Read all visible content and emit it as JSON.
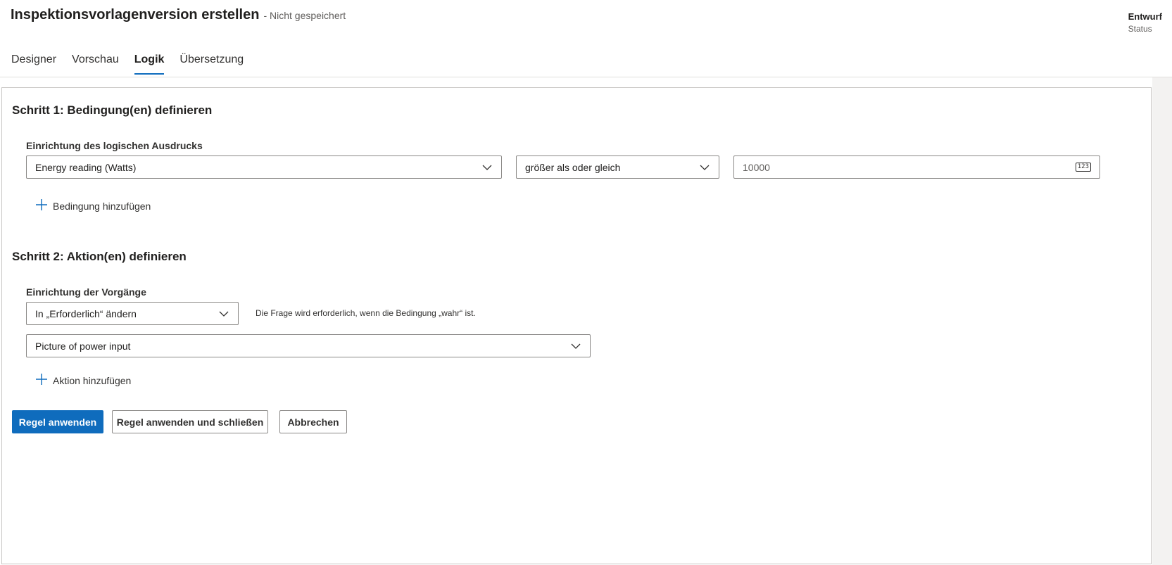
{
  "header": {
    "title": "Inspektionsvorlagenversion erstellen",
    "save_status": "- Nicht gespeichert",
    "status_value": "Entwurf",
    "status_label": "Status"
  },
  "tabs": [
    {
      "label": "Designer",
      "active": false
    },
    {
      "label": "Vorschau",
      "active": false
    },
    {
      "label": "Logik",
      "active": true
    },
    {
      "label": "Übersetzung",
      "active": false
    }
  ],
  "step1": {
    "title": "Schritt 1: Bedingung(en) definieren",
    "field_label": "Einrichtung des logischen Ausdrucks",
    "question_value": "Energy reading (Watts)",
    "operator_value": "größer als oder gleich",
    "number_value": "10000",
    "number_badge": "123",
    "add_condition_label": "Bedingung hinzufügen"
  },
  "step2": {
    "title": "Schritt 2: Aktion(en) definieren",
    "field_label": "Einrichtung der Vorgänge",
    "action_value": "In „Erforderlich“ ändern",
    "helper_text": "Die Frage wird erforderlich, wenn die Bedingung „wahr“ ist.",
    "target_value": "Picture of power input",
    "add_action_label": "Aktion hinzufügen"
  },
  "buttons": {
    "apply": "Regel anwenden",
    "apply_close": "Regel anwenden und schließen",
    "cancel": "Abbrechen"
  },
  "colors": {
    "accent": "#0f6cbd",
    "border": "#8a8886"
  },
  "icons": {
    "chevron": "chevron-down-icon",
    "add": "add-icon",
    "number": "number-icon"
  }
}
